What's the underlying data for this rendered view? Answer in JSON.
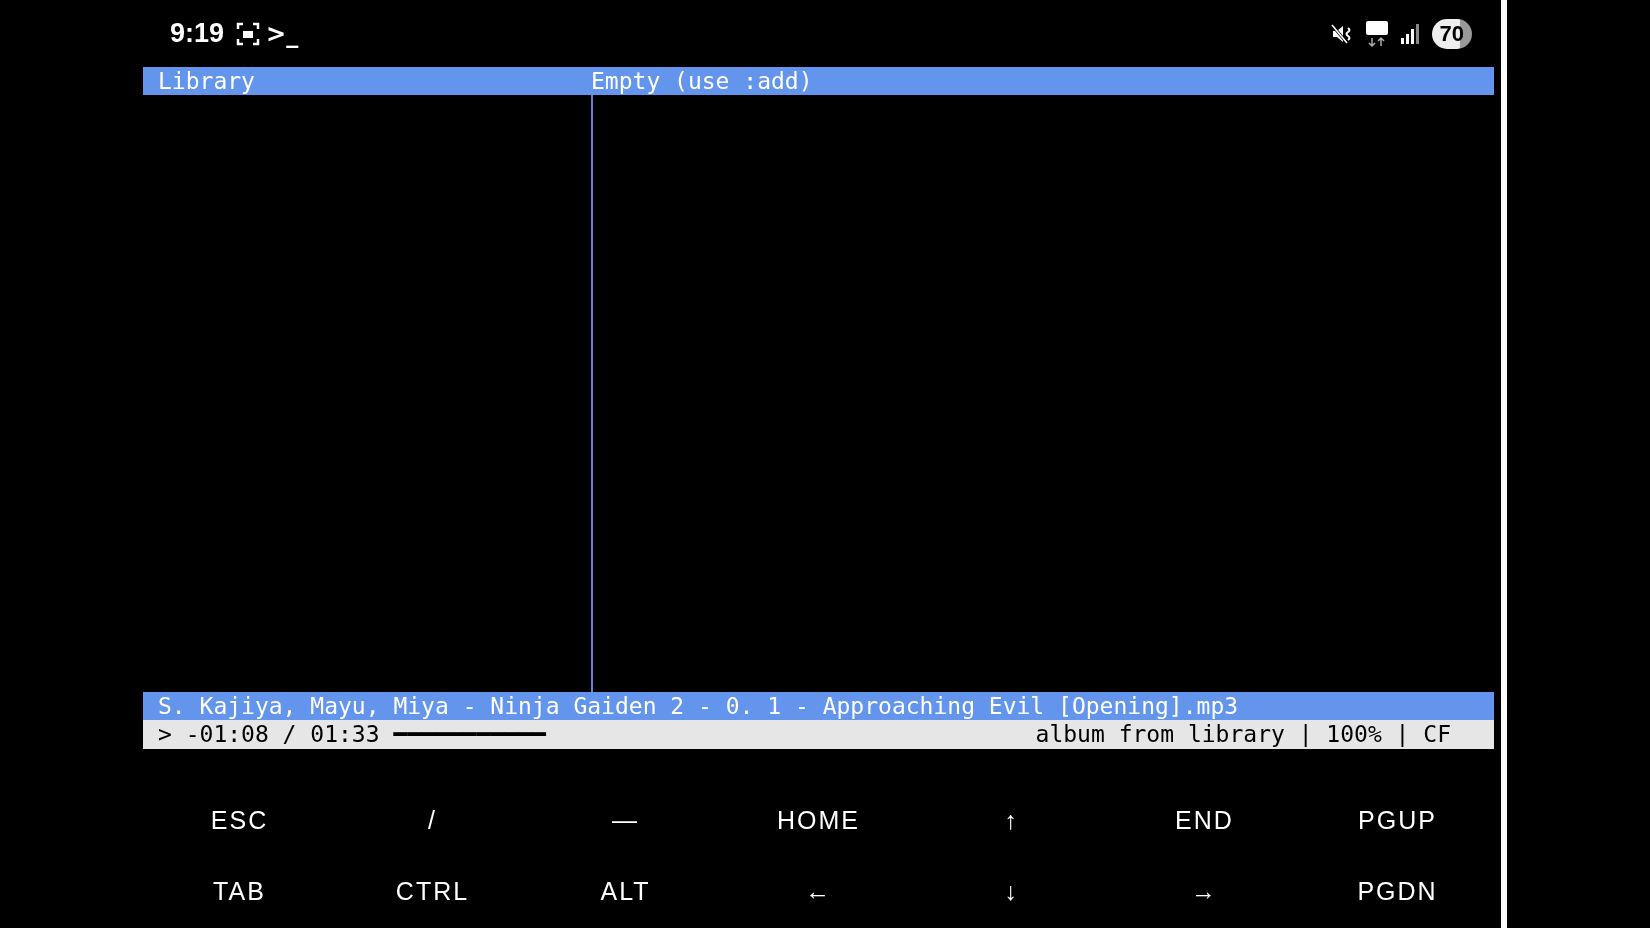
{
  "status_bar": {
    "time": "9:19",
    "prompt": ">_",
    "battery": "70"
  },
  "panes": {
    "left_title": "Library",
    "right_title": "Empty (use :add)"
  },
  "now_playing": {
    "track": "S. Kajiya, Mayu, Miya - Ninja Gaiden 2 - 0. 1 - Approaching Evil [Opening].mp3",
    "position": "> -01:08 / 01:33",
    "progress_line": "━━━━━━━━━━━",
    "info": "album from library | 100% | CF"
  },
  "extra_keys": [
    [
      "ESC",
      "/",
      "—",
      "HOME",
      "↑",
      "END",
      "PGUP"
    ],
    [
      "TAB",
      "CTRL",
      "ALT",
      "←",
      "↓",
      "→",
      "PGDN"
    ]
  ]
}
